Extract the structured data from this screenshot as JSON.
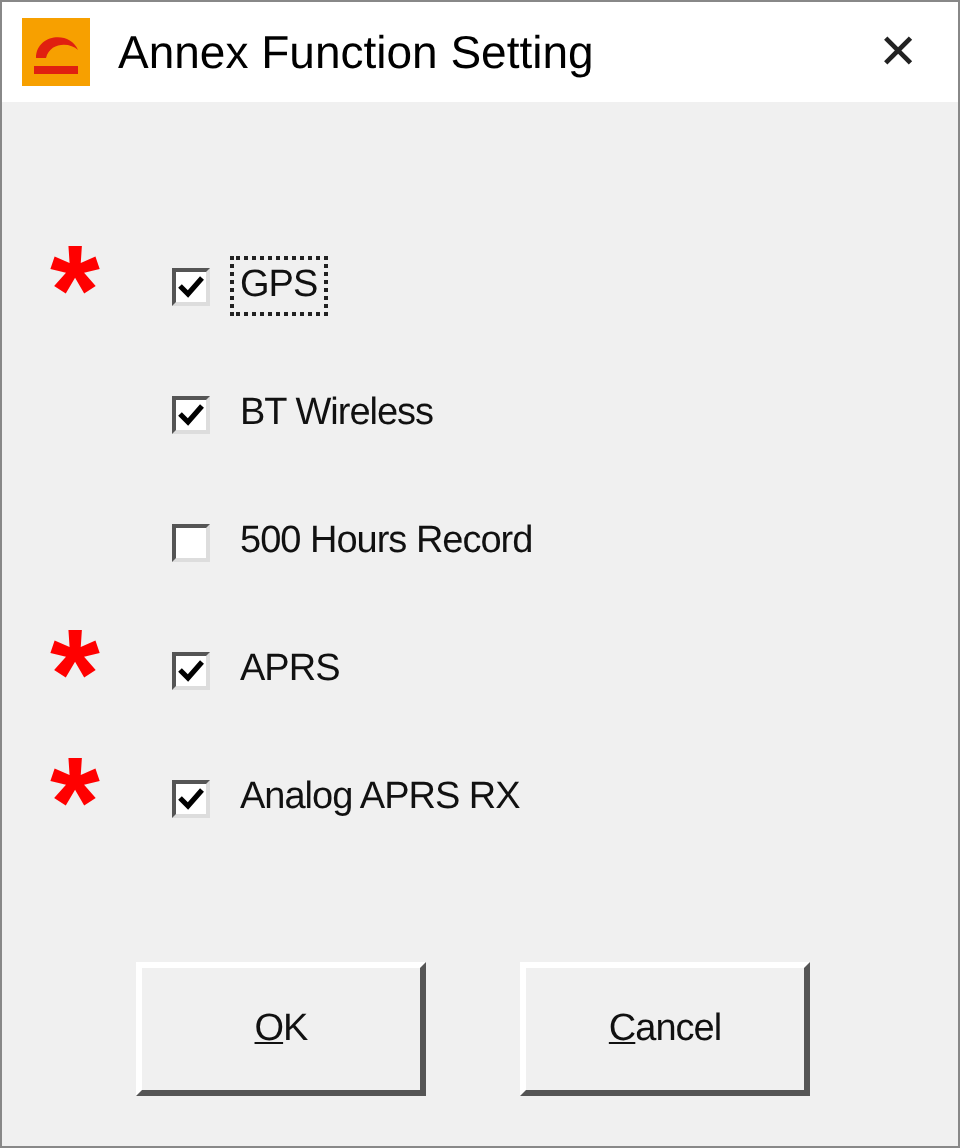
{
  "window": {
    "title": "Annex Function Setting",
    "close": "✕"
  },
  "options": [
    {
      "label": "GPS",
      "checked": true,
      "focused": true,
      "marker": "*"
    },
    {
      "label": "BT Wireless",
      "checked": true,
      "focused": false
    },
    {
      "label": "500 Hours Record",
      "checked": false,
      "focused": false
    },
    {
      "label": "APRS",
      "checked": true,
      "focused": false,
      "marker": "*"
    },
    {
      "label": "Analog APRS RX",
      "checked": true,
      "focused": false,
      "marker": "*"
    }
  ],
  "buttons": [
    {
      "access_key": "O",
      "rest": "K"
    },
    {
      "access_key": "C",
      "rest": "ancel"
    }
  ]
}
